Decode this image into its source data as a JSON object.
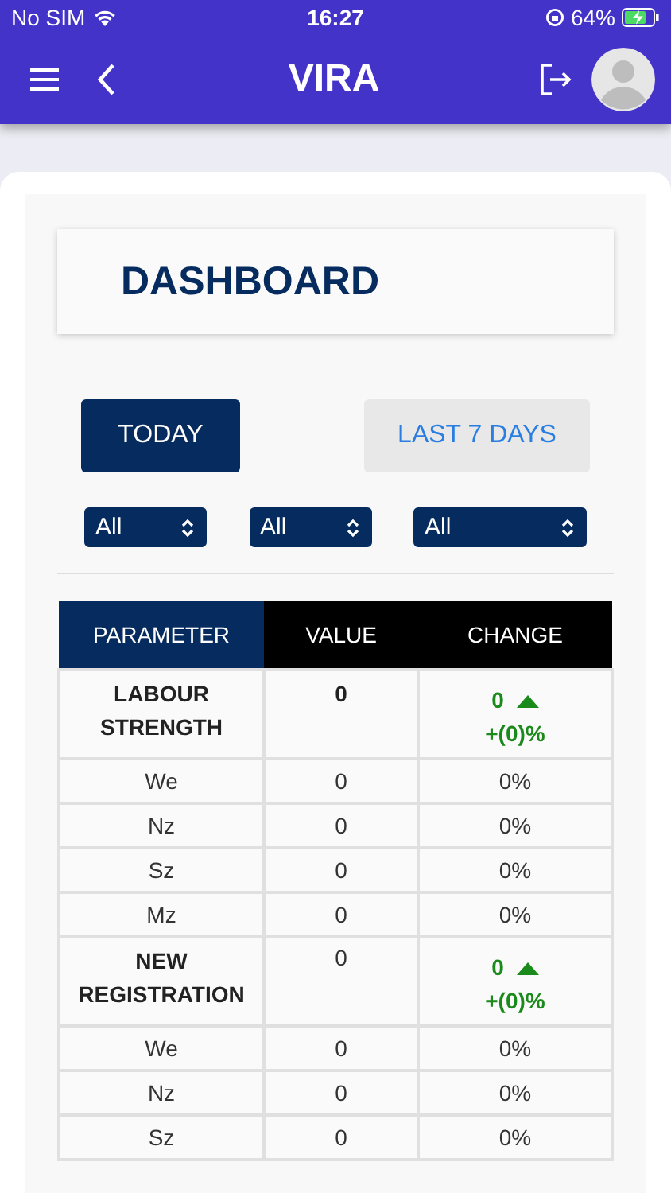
{
  "status_bar": {
    "carrier": "No SIM",
    "time": "16:27",
    "battery": "64%"
  },
  "app_bar": {
    "title": "VIRA"
  },
  "page_title": "DASHBOARD",
  "periods": [
    {
      "label": "TODAY",
      "selected": true
    },
    {
      "label": "LAST 7 DAYS",
      "selected": false
    }
  ],
  "filters": [
    "All",
    "All",
    "All"
  ],
  "table": {
    "columns": [
      "PARAMETER",
      "VALUE",
      "CHANGE"
    ],
    "groups": [
      {
        "name": "LABOUR STRENGTH",
        "value": "0",
        "value_bold": true,
        "change": "0",
        "change_pct": "+(0)%",
        "rising": true,
        "rows": [
          {
            "name": "We",
            "value": "0",
            "change": "0%"
          },
          {
            "name": "Nz",
            "value": "0",
            "change": "0%"
          },
          {
            "name": "Sz",
            "value": "0",
            "change": "0%"
          },
          {
            "name": "Mz",
            "value": "0",
            "change": "0%"
          }
        ]
      },
      {
        "name": "NEW REGISTRATION",
        "value": "0",
        "value_bold": false,
        "change": "0",
        "change_pct": "+(0)%",
        "rising": true,
        "rows": [
          {
            "name": "We",
            "value": "0",
            "change": "0%"
          },
          {
            "name": "Nz",
            "value": "0",
            "change": "0%"
          },
          {
            "name": "Sz",
            "value": "0",
            "change": "0%"
          }
        ]
      }
    ]
  }
}
